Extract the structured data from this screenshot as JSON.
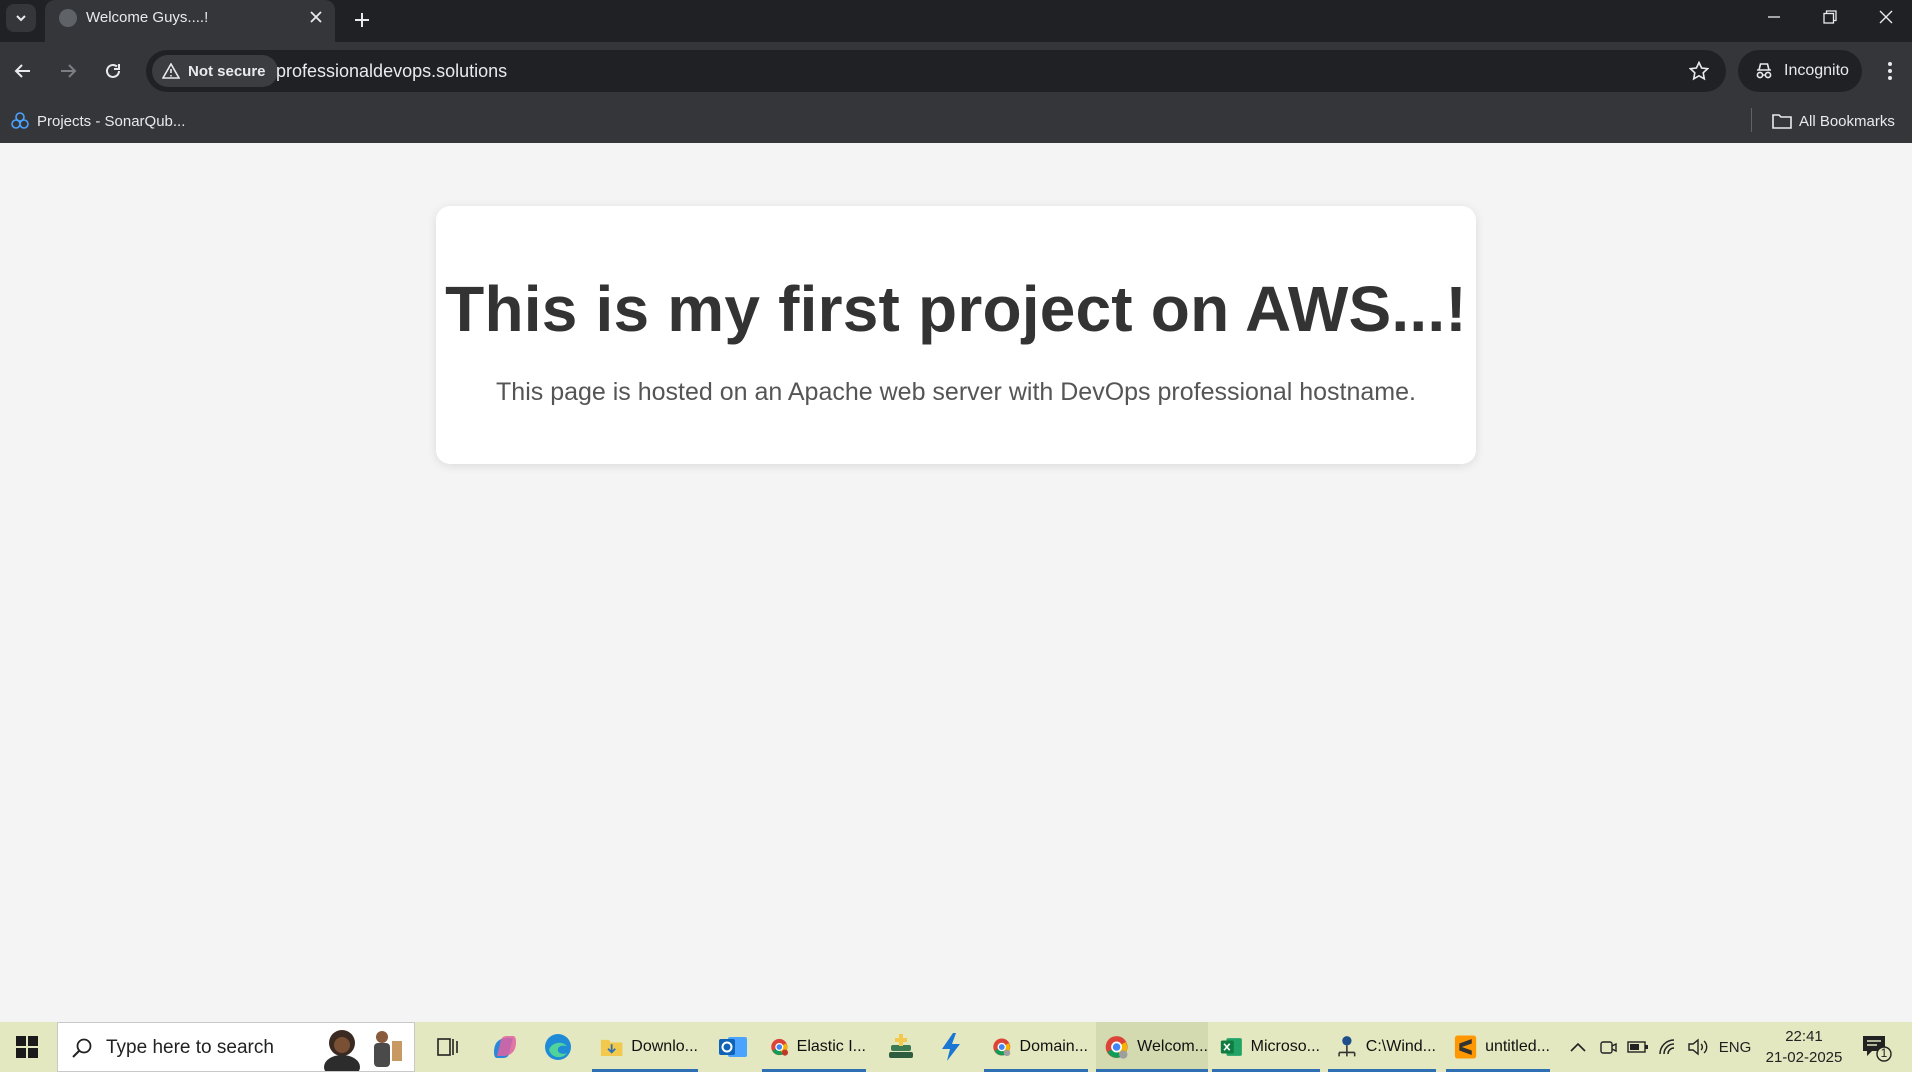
{
  "browser": {
    "tab_title": "Welcome Guys....!",
    "security_label": "Not secure",
    "url": "professionaldevops.solutions",
    "incognito_label": "Incognito",
    "bookmarks": [
      {
        "label": "Projects - SonarQub..."
      }
    ],
    "all_bookmarks_label": "All Bookmarks"
  },
  "page": {
    "heading": "This is my first project on AWS...!",
    "description": "This page is hosted on an Apache web server with DevOps professional hostname."
  },
  "taskbar": {
    "search_placeholder": "Type here to search",
    "items": [
      {
        "label": "Downlo...",
        "icon": "folder-icon"
      },
      {
        "label": "Elastic I...",
        "icon": "chrome-icon"
      },
      {
        "label": "Domain...",
        "icon": "chrome-icon"
      },
      {
        "label": "Welcom...",
        "icon": "chrome-icon"
      },
      {
        "label": "Microso...",
        "icon": "excel-icon"
      },
      {
        "label": "C:\\Wind...",
        "icon": "network-icon"
      },
      {
        "label": "untitled...",
        "icon": "sublime-icon"
      }
    ],
    "language": "ENG",
    "time": "22:41",
    "date": "21-02-2025",
    "notification_count": "1"
  },
  "colors": {
    "tabstrip": "#202124",
    "toolbar": "#35363a",
    "page_bg": "#f4f4f4",
    "card_bg": "#ffffff",
    "heading": "#333333",
    "taskbar": "#e3e8c0",
    "taskbar_active": "#2f6fb3"
  }
}
